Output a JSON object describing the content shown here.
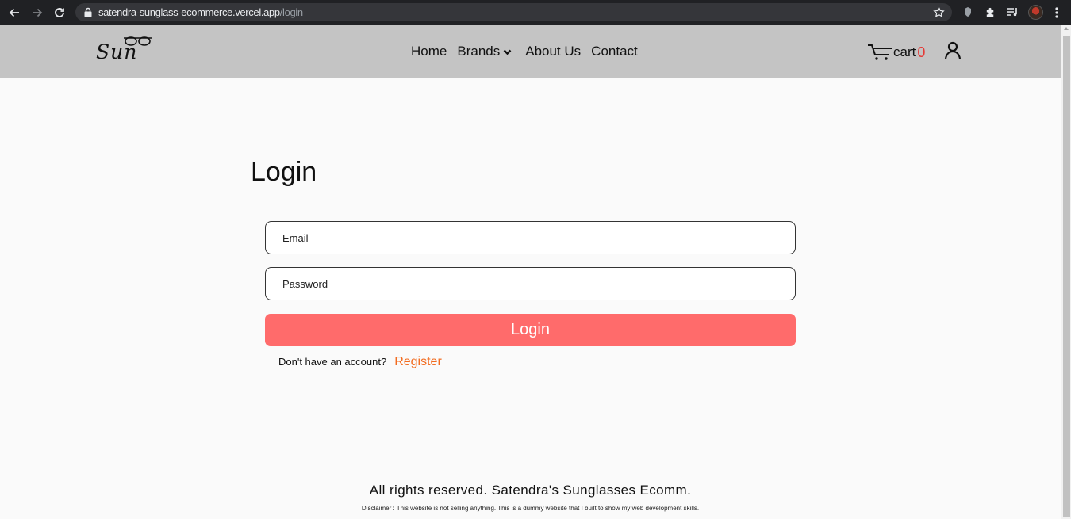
{
  "browser": {
    "url_host": "satendra-sunglass-ecommerce.vercel.app",
    "url_path": "/login"
  },
  "header": {
    "logo_text": "Sun",
    "nav": {
      "home": "Home",
      "brands": "Brands",
      "about": "About Us",
      "contact": "Contact"
    },
    "cart_label": "cart",
    "cart_count": "0"
  },
  "login": {
    "title": "Login",
    "email_placeholder": "Email",
    "password_placeholder": "Password",
    "submit_label": "Login",
    "register_prompt": "Don't have an account?",
    "register_link": "Register"
  },
  "footer": {
    "rights": "All rights reserved. Satendra's Sunglasses Ecomm.",
    "disclaimer": "Disclaimer : This website is not selling anything. This is a dummy website that I built to show my web development skills."
  },
  "icons": {
    "back": "arrow-left-icon",
    "forward": "arrow-right-icon",
    "reload": "reload-icon",
    "lock": "lock-icon",
    "bookmark": "star-icon",
    "extension_shield": "shield-icon",
    "extensions": "puzzle-icon",
    "media": "playlist-icon",
    "menu": "kebab-icon",
    "brands_caret": "chevron-down-icon",
    "cart": "cart-icon",
    "user": "user-icon"
  },
  "colors": {
    "header_bg": "#c4c4c4",
    "login_button": "#ff6b6b",
    "register_link": "#f26b1f",
    "cart_count": "#e53935"
  }
}
